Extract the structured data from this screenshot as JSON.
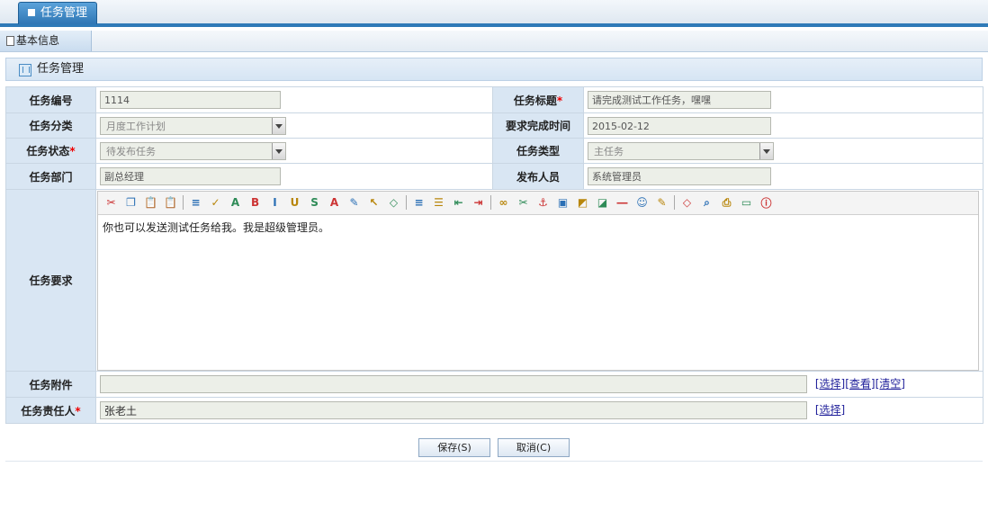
{
  "top_tab": {
    "label": "任务管理"
  },
  "sub_tab": {
    "label": "基本信息"
  },
  "section": {
    "title": "任务管理"
  },
  "form": {
    "task_no": {
      "label": "任务编号",
      "value": "1114"
    },
    "task_title": {
      "label": "任务标题",
      "required": "*",
      "value": "请完成测试工作任务，嘿嘿"
    },
    "task_category": {
      "label": "任务分类",
      "value": "月度工作计划"
    },
    "due_time": {
      "label": "要求完成时间",
      "value": "2015-02-12"
    },
    "task_status": {
      "label": "任务状态",
      "required": "*",
      "value": "待发布任务"
    },
    "task_type": {
      "label": "任务类型",
      "value": "主任务"
    },
    "task_dept": {
      "label": "任务部门",
      "value": "副总经理"
    },
    "publisher": {
      "label": "发布人员",
      "value": "系统管理员"
    },
    "requirement": {
      "label": "任务要求",
      "content": "你也可以发送测试任务给我。我是超级管理员。"
    },
    "attachment": {
      "label": "任务附件",
      "value": "",
      "select": "[选择]",
      "view": "[查看]",
      "clear": "[清空]"
    },
    "owner": {
      "label": "任务责任人",
      "required": "*",
      "value": "张老土",
      "select": "[选择]"
    }
  },
  "buttons": {
    "save": "保存(S)",
    "cancel": "取消(C)"
  },
  "toolbar_icons": [
    "cut-icon",
    "copy-icon",
    "paste-icon",
    "paste-word-icon",
    "|",
    "paragraph-icon",
    "spellcheck-icon",
    "font-size-icon",
    "bold-icon",
    "italic-icon",
    "underline-icon",
    "strikethrough-icon",
    "font-color-icon",
    "highlight-icon",
    "select-icon",
    "eraser-icon",
    "|",
    "align-left-icon",
    "list-icon",
    "outdent-icon",
    "indent-icon",
    "|",
    "link-icon",
    "unlink-icon",
    "anchor-icon",
    "image-upload-icon",
    "flash-icon",
    "media-icon",
    "horizontal-rule-icon",
    "emoticon-icon",
    "edit-note-icon",
    "|",
    "source-code-icon",
    "preview-icon",
    "print-icon",
    "fullscreen-icon",
    "about-icon"
  ],
  "toolbar_glyphs": {
    "cut-icon": "✂",
    "copy-icon": "❐",
    "paste-icon": "📋",
    "paste-word-icon": "📋",
    "paragraph-icon": "≡",
    "spellcheck-icon": "✓",
    "font-size-icon": "A",
    "bold-icon": "B",
    "italic-icon": "I",
    "underline-icon": "U",
    "strikethrough-icon": "S",
    "font-color-icon": "A",
    "highlight-icon": "✎",
    "select-icon": "↖",
    "eraser-icon": "◇",
    "align-left-icon": "≡",
    "list-icon": "☰",
    "outdent-icon": "⇤",
    "indent-icon": "⇥",
    "link-icon": "∞",
    "unlink-icon": "✂",
    "anchor-icon": "⚓",
    "image-upload-icon": "▣",
    "flash-icon": "◩",
    "media-icon": "◪",
    "horizontal-rule-icon": "―",
    "emoticon-icon": "☺",
    "edit-note-icon": "✎",
    "source-code-icon": "◇",
    "preview-icon": "⌕",
    "print-icon": "⎙",
    "fullscreen-icon": "▭",
    "about-icon": "ⓘ"
  }
}
